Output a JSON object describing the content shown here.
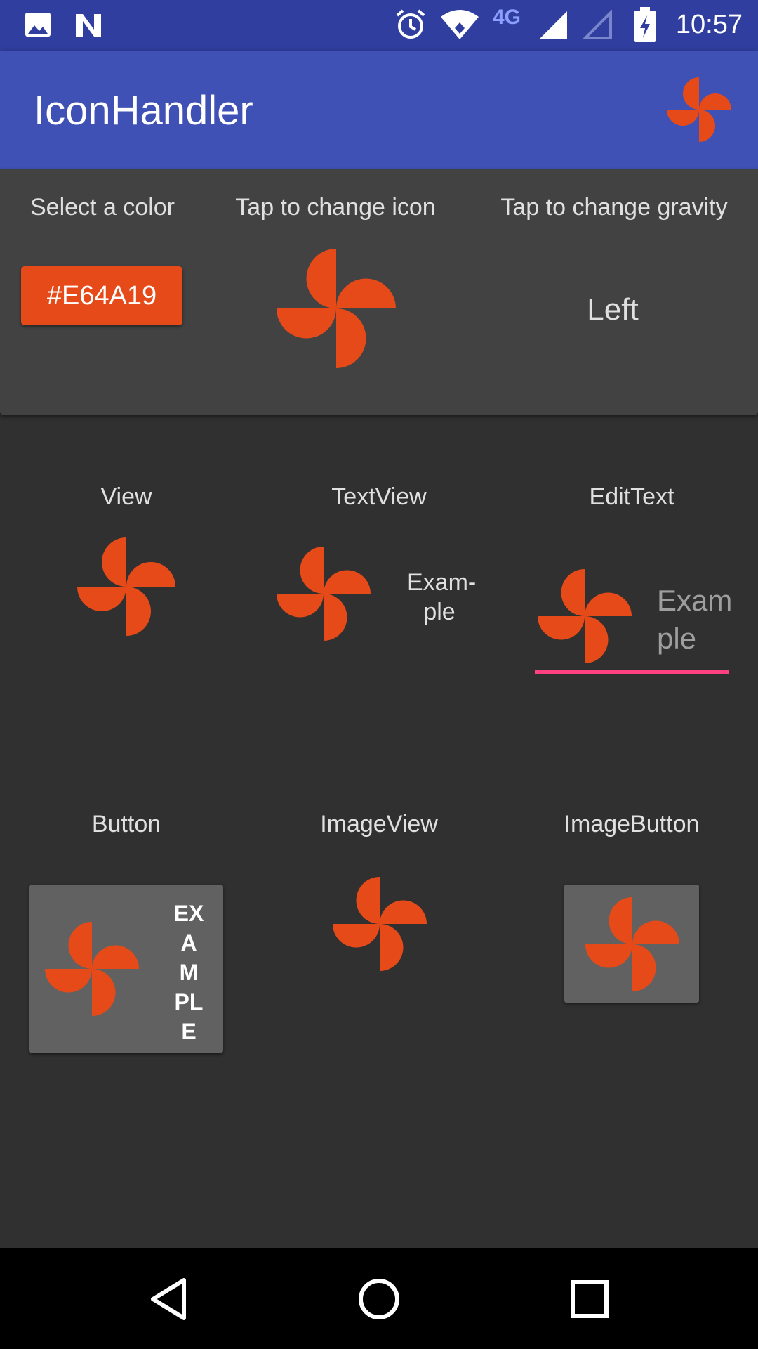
{
  "status_bar": {
    "time": "10:57",
    "network": "4G",
    "icons": [
      "image-icon",
      "n-icon",
      "alarm-icon",
      "wifi-icon",
      "signal-icon",
      "signal-empty-icon",
      "battery-charging-icon"
    ]
  },
  "app_bar": {
    "title": "IconHandler",
    "action_icon": "pinwheel-icon"
  },
  "controls": {
    "color_label": "Select a color",
    "color_value": "#E64A19",
    "icon_label": "Tap to change icon",
    "gravity_label": "Tap to change gravity",
    "gravity_value": "Left"
  },
  "demos": {
    "view": {
      "label": "View"
    },
    "textview": {
      "label": "TextView",
      "text": "Exam-ple"
    },
    "edittext": {
      "label": "EditText",
      "text": "Example"
    },
    "button": {
      "label": "Button",
      "text": "EXAMPLE"
    },
    "imageview": {
      "label": "ImageView"
    },
    "imagebutton": {
      "label": "ImageButton"
    }
  },
  "nav_bar": {
    "icons": [
      "back-icon",
      "home-icon",
      "recents-icon"
    ]
  },
  "colors": {
    "accent": "#E64A19",
    "primary": "#3F51B5",
    "primary_dark": "#303F9F",
    "edit_underline": "#FF4081"
  }
}
